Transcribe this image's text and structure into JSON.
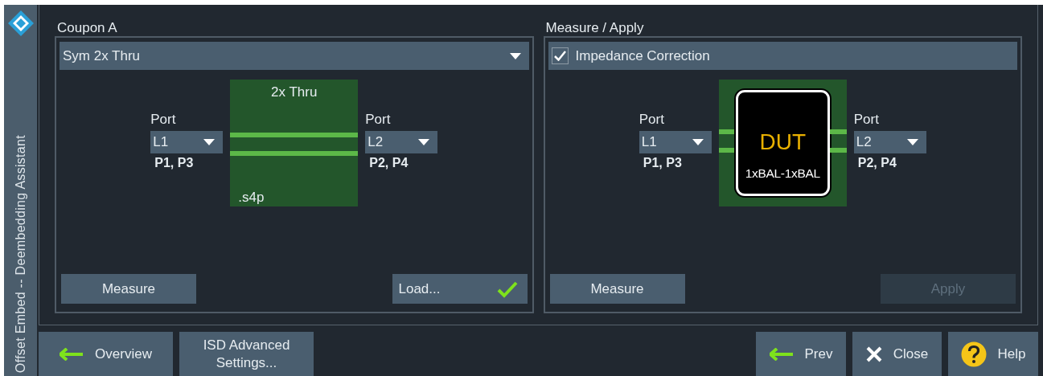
{
  "sidebar": {
    "title": "Offset Embed -- Deembedding Assistant"
  },
  "coupon": {
    "title": "Coupon A",
    "type_dropdown": {
      "value": "Sym 2x Thru"
    },
    "diagram": {
      "kind": "thru",
      "label": "2x Thru",
      "file": ".s4p"
    },
    "ports": [
      {
        "label": "Port",
        "value": "L1",
        "pins": "P1, P3"
      },
      {
        "label": "Port",
        "value": "L2",
        "pins": "P2, P4"
      }
    ],
    "buttons": [
      {
        "label": "Measure",
        "done": false
      },
      {
        "label": "Load...",
        "done": true
      }
    ]
  },
  "measure_apply": {
    "title": "Measure / Apply",
    "impedance_correction": {
      "label": "Impedance Correction",
      "checked": true
    },
    "diagram": {
      "kind": "dut",
      "label": "DUT",
      "sublabel": "1xBAL-1xBAL"
    },
    "ports": [
      {
        "label": "Port",
        "value": "L1",
        "pins": "P1, P3"
      },
      {
        "label": "Port",
        "value": "L2",
        "pins": "P2, P4"
      }
    ],
    "buttons": [
      {
        "label": "Measure",
        "disabled": false
      },
      {
        "label": "Apply",
        "disabled": true
      }
    ]
  },
  "footer_left": [
    {
      "label": "Overview",
      "kind": "back"
    },
    {
      "label": "ISD Advanced Settings...",
      "kind": "text"
    }
  ],
  "footer_right": [
    {
      "label": "Prev",
      "kind": "back"
    },
    {
      "label": "Close",
      "kind": "close"
    },
    {
      "label": "Help",
      "kind": "help"
    }
  ]
}
